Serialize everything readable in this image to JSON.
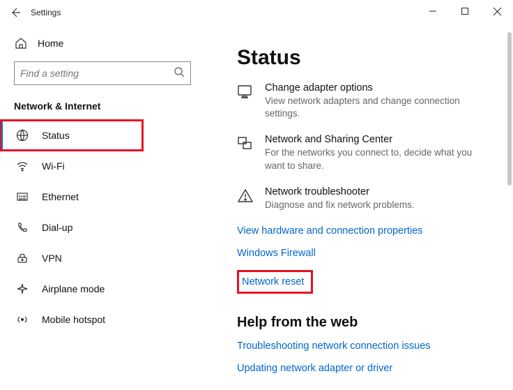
{
  "titlebar": {
    "title": "Settings"
  },
  "sidebar": {
    "home": "Home",
    "search_placeholder": "Find a setting",
    "group": "Network & Internet",
    "items": [
      {
        "label": "Status"
      },
      {
        "label": "Wi-Fi"
      },
      {
        "label": "Ethernet"
      },
      {
        "label": "Dial-up"
      },
      {
        "label": "VPN"
      },
      {
        "label": "Airplane mode"
      },
      {
        "label": "Mobile hotspot"
      }
    ]
  },
  "main": {
    "title": "Status",
    "options": [
      {
        "title": "Change adapter options",
        "desc": "View network adapters and change connection settings."
      },
      {
        "title": "Network and Sharing Center",
        "desc": "For the networks you connect to, decide what you want to share."
      },
      {
        "title": "Network troubleshooter",
        "desc": "Diagnose and fix network problems."
      }
    ],
    "links": [
      "View hardware and connection properties",
      "Windows Firewall",
      "Network reset"
    ],
    "help_title": "Help from the web",
    "help_links": [
      "Troubleshooting network connection issues",
      "Updating network adapter or driver"
    ]
  }
}
